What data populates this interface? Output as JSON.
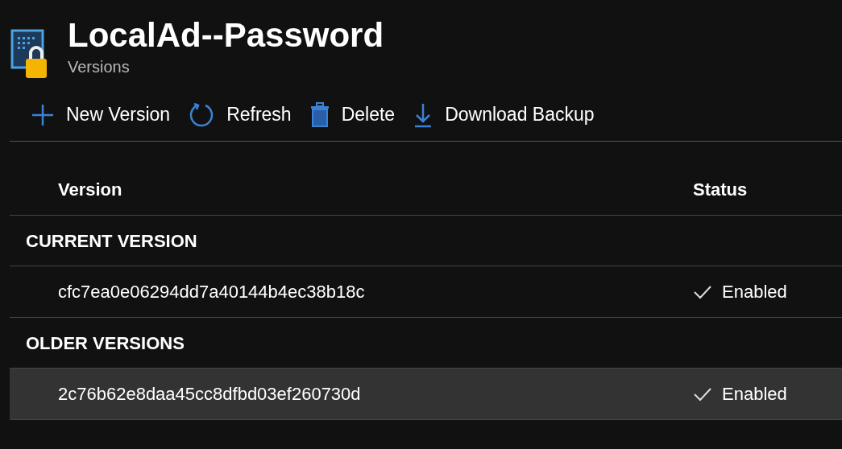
{
  "header": {
    "title": "LocalAd--Password",
    "subtitle": "Versions"
  },
  "toolbar": [
    {
      "kind": "add",
      "label": "New Version"
    },
    {
      "kind": "refresh",
      "label": "Refresh"
    },
    {
      "kind": "delete",
      "label": "Delete"
    },
    {
      "kind": "download",
      "label": "Download Backup"
    }
  ],
  "table": {
    "columns": [
      "Version",
      "Status"
    ],
    "groups": [
      {
        "title": "CURRENT VERSION",
        "rows": [
          {
            "version": "cfc7ea0e06294dd7a40144b4ec38b18c",
            "status": "Enabled",
            "selected": false
          }
        ]
      },
      {
        "title": "OLDER VERSIONS",
        "rows": [
          {
            "version": "2c76b62e8daa45cc8dfbd03ef260730d",
            "status": "Enabled",
            "selected": true
          }
        ]
      }
    ]
  }
}
